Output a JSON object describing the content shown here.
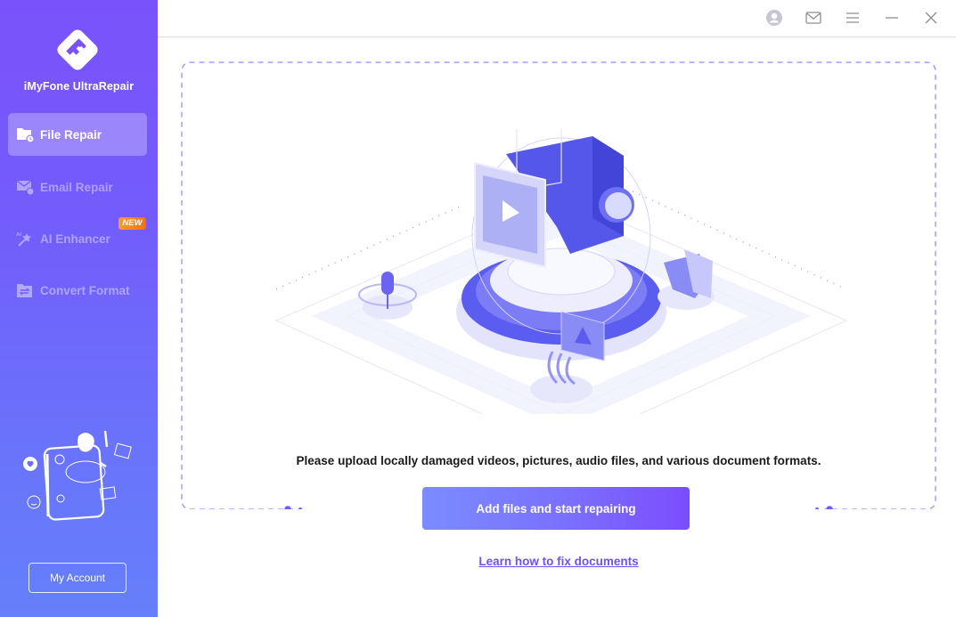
{
  "app": {
    "name": "iMyFone UltraRepair",
    "brand_color": "#7a52fb",
    "accent_color": "#7052ee"
  },
  "sidebar": {
    "items": [
      {
        "label": "File Repair",
        "icon": "file-repair-icon",
        "active": true
      },
      {
        "label": "Email Repair",
        "icon": "email-repair-icon",
        "active": false
      },
      {
        "label": "AI Enhancer",
        "icon": "ai-enhancer-icon",
        "active": false,
        "badge": "NEW"
      },
      {
        "label": "Convert Format",
        "icon": "convert-format-icon",
        "active": false
      }
    ],
    "account_button": "My Account"
  },
  "titlebar": {
    "icons": [
      "user-icon",
      "mail-icon",
      "menu-icon",
      "minimize-icon",
      "close-icon"
    ]
  },
  "main": {
    "instruction": "Please upload locally damaged videos, pictures, audio files, and various document formats.",
    "primary_button": "Add files and start repairing",
    "help_link": "Learn how to fix documents"
  }
}
